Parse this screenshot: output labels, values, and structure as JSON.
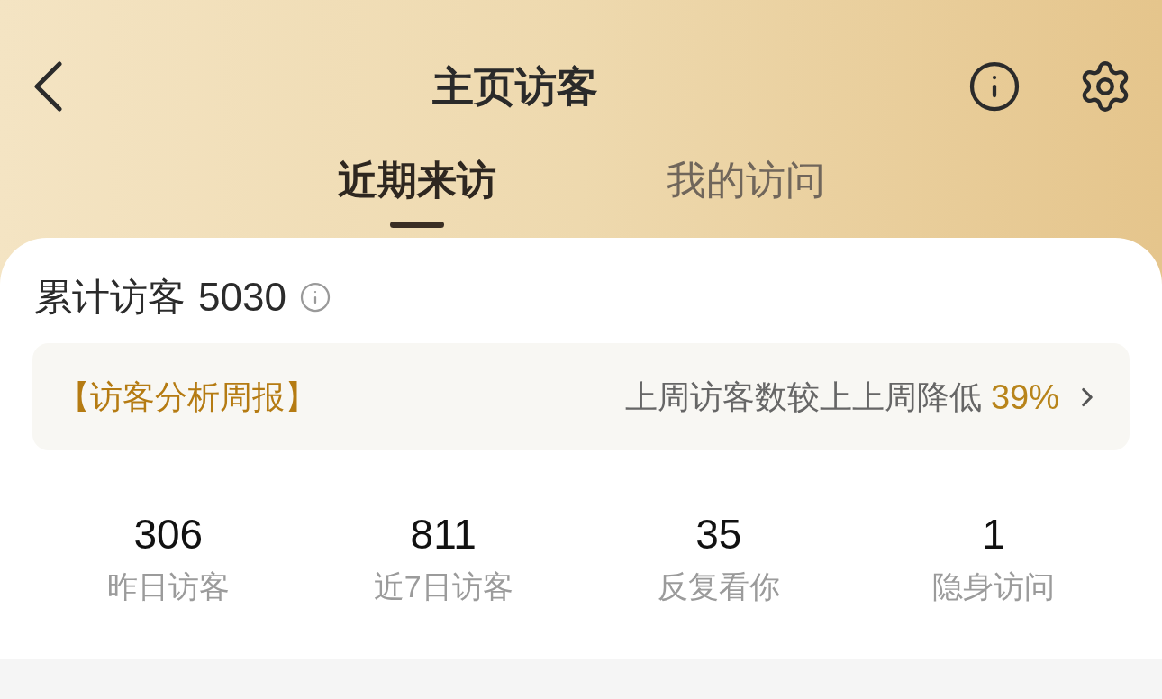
{
  "header": {
    "title": "主页访客"
  },
  "tabs": [
    {
      "label": "近期来访",
      "selected": true
    },
    {
      "label": "我的访问",
      "selected": false
    }
  ],
  "summary": {
    "label": "累计访客",
    "count": "5030"
  },
  "report": {
    "tag": "【访客分析周报】",
    "text": "上周访客数较上上周降低",
    "change": "39%"
  },
  "stats": [
    {
      "value": "306",
      "label": "昨日访客"
    },
    {
      "value": "811",
      "label": "近7日访客"
    },
    {
      "value": "35",
      "label": "反复看你"
    },
    {
      "value": "1",
      "label": "隐身访问"
    }
  ]
}
